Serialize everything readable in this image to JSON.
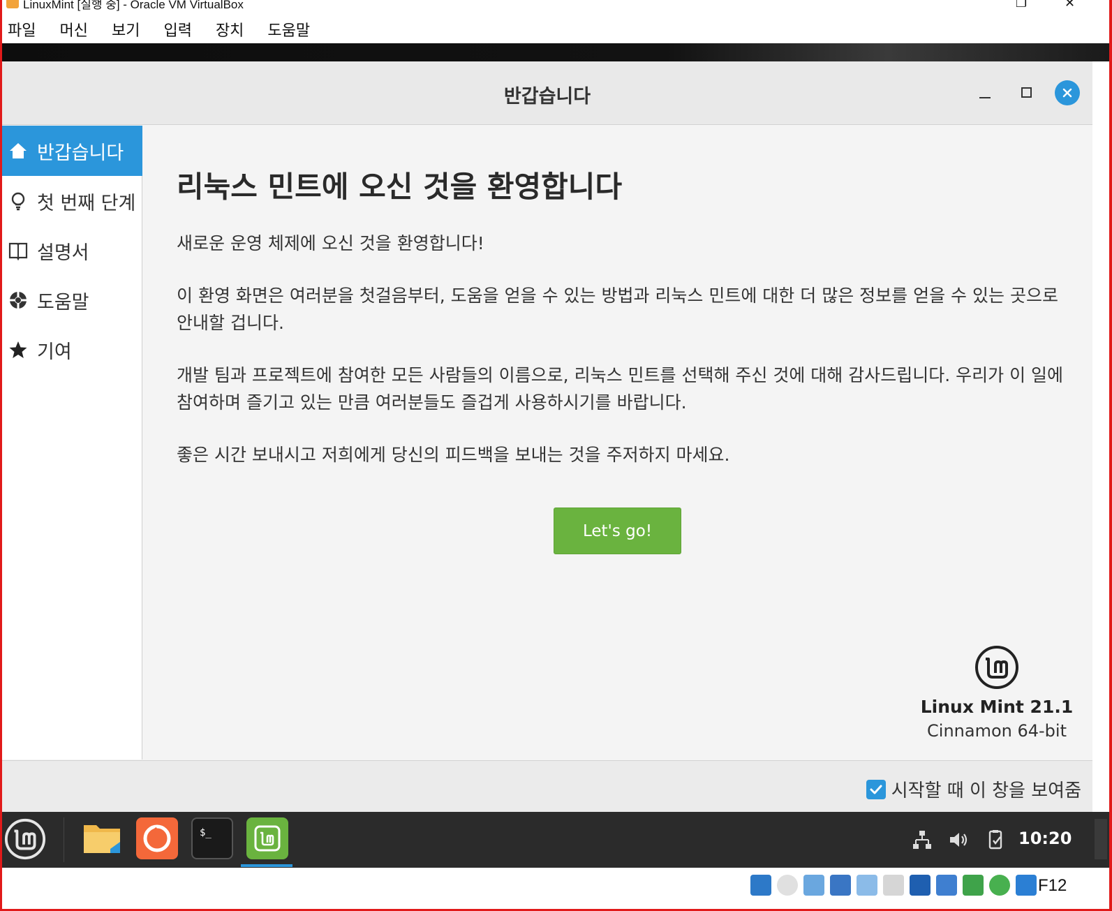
{
  "host": {
    "title": "LinuxMint [실행 중] - Oracle VM VirtualBox",
    "menu": [
      "파일",
      "머신",
      "보기",
      "입력",
      "장치",
      "도움말"
    ],
    "host_key": "F12"
  },
  "window": {
    "title": "반갑습니다"
  },
  "sidebar": {
    "items": [
      {
        "label": "반갑습니다",
        "icon": "home-icon"
      },
      {
        "label": "첫 번째 단계",
        "icon": "lightbulb-icon"
      },
      {
        "label": "설명서",
        "icon": "book-icon"
      },
      {
        "label": "도움말",
        "icon": "lifebuoy-icon"
      },
      {
        "label": "기여",
        "icon": "star-icon"
      }
    ]
  },
  "content": {
    "heading": "리눅스 민트에 오신 것을 환영합니다",
    "paragraphs": [
      "새로운 운영 체제에 오신 것을 환영합니다!",
      "이 환영 화면은 여러분을 첫걸음부터, 도움을 얻을 수 있는 방법과 리눅스 민트에 대한 더 많은 정보를 얻을 수 있는 곳으로 안내할 겁니다.",
      "개발 팀과 프로젝트에 참여한 모든 사람들의 이름으로, 리눅스 민트를 선택해 주신 것에 대해 감사드립니다. 우리가 이 일에 참여하며 즐기고 있는 만큼 여러분들도 즐겁게 사용하시기를 바랍니다.",
      "좋은 시간 보내시고 저희에게 당신의 피드백을 보내는 것을 주저하지 마세요."
    ],
    "go_button": "Let's go!",
    "brand_name": "Linux Mint 21.1",
    "brand_edition": "Cinnamon 64-bit"
  },
  "footer": {
    "show_on_startup_label": "시작할 때 이 창을 보여줌",
    "show_on_startup_checked": true
  },
  "taskbar": {
    "clock": "10:20"
  },
  "colors": {
    "accent": "#2b96db",
    "mint_green": "#6ab33f",
    "frame_red": "#e11a1a",
    "taskbar": "#2b2b2b"
  }
}
